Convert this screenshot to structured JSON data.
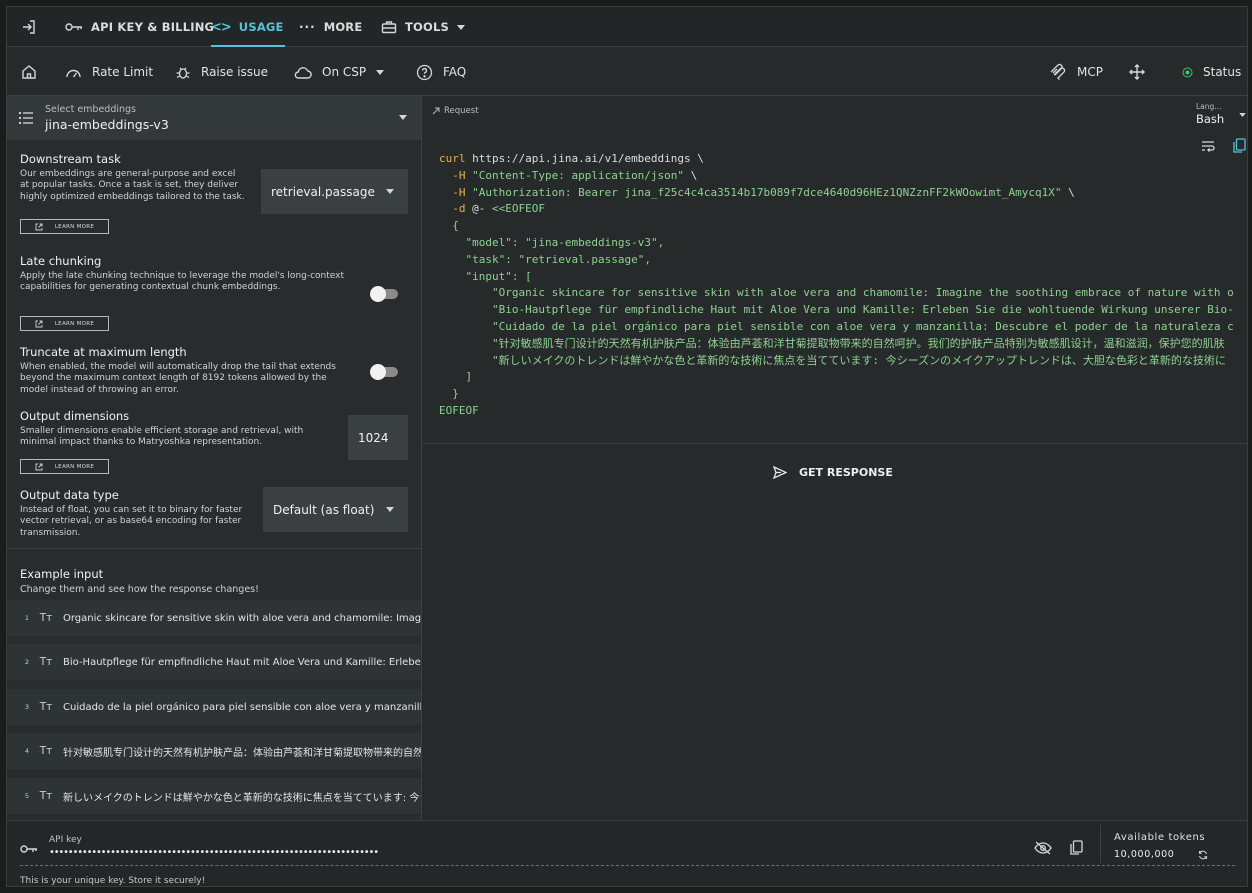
{
  "tabs": [
    {
      "label": "API KEY & BILLING"
    },
    {
      "label": "USAGE"
    },
    {
      "label": "MORE"
    },
    {
      "label": "TOOLS"
    }
  ],
  "toolbar": {
    "rate_limit": "Rate Limit",
    "raise_issue": "Raise issue",
    "on_csp": "On CSP",
    "faq": "FAQ",
    "mcp": "MCP",
    "status": "Status"
  },
  "embeddings": {
    "label": "Select embeddings",
    "value": "jina-embeddings-v3"
  },
  "settings": {
    "learn_more": "LEARN MORE",
    "downstream": {
      "title": "Downstream task",
      "desc": "Our embeddings are general-purpose and excel at popular tasks. Once a task is set, they deliver highly optimized embeddings tailored to the task.",
      "value": "retrieval.passage"
    },
    "late_chunking": {
      "title": "Late chunking",
      "desc": "Apply the late chunking technique to leverage the model's long-context capabilities for generating contextual chunk embeddings."
    },
    "truncate": {
      "title": "Truncate at maximum length",
      "desc": "When enabled, the model will automatically drop the tail that extends beyond the maximum context length of 8192 tokens allowed by the model instead of throwing an error."
    },
    "dimensions": {
      "title": "Output dimensions",
      "desc": "Smaller dimensions enable efficient storage and retrieval, with minimal impact thanks to Matryoshka representation.",
      "value": "1024"
    },
    "datatype": {
      "title": "Output data type",
      "desc": "Instead of float, you can set it to binary for faster vector retrieval, or as base64 encoding for faster transmission.",
      "value": "Default (as float)"
    }
  },
  "example": {
    "title": "Example input",
    "subtitle": "Change them and see how the response changes!",
    "tt_glyph": "Tт",
    "items": [
      {
        "n": "1",
        "text": "Organic skincare for sensitive skin with aloe vera and chamomile: Imagine the soothing embrace of nature with our organic skincare range"
      },
      {
        "n": "2",
        "text": "Bio-Hautpflege für empfindliche Haut mit Aloe Vera und Kamille: Erleben Sie die wohltuende Wirkung unserer Bio-Hautpflege"
      },
      {
        "n": "3",
        "text": "Cuidado de la piel orgánico para piel sensible con aloe vera y manzanilla: Descubre el poder de la naturaleza con nuestra línea"
      },
      {
        "n": "4",
        "text": "针对敏感肌专门设计的天然有机护肤产品：体验由芦荟和洋甘菊提取物带来的自然呵护。我们的护肤产品特别为敏感肌设计"
      },
      {
        "n": "5",
        "text": "新しいメイクのトレンドは鮮やかな色と革新的な技術に焦点を当てています: 今シーズンのメイクアップトレンドは、大胆な色彩と革新的な技術に"
      }
    ]
  },
  "request": {
    "label": "Request",
    "lang_label": "Lang...",
    "lang_value": "Bash",
    "get_response": "GET RESPONSE"
  },
  "code": {
    "l1a": "curl",
    "l1b": " https://api.jina.ai/v1/embeddings \\",
    "l2a": "  -H",
    "l2b": " \"Content-Type: application/json\"",
    "l2c": " \\",
    "l3a": "  -H",
    "l3b": " \"Authorization: Bearer jina_f25c4c4ca3514b17b089f7dce4640d96HEz1QNZznFF2kWOowimt_Amycq1X\"",
    "l3c": " \\",
    "l4a": "  -d",
    "l4b": " @- ",
    "l4c": "<<EOFEOF",
    "l5": "  {",
    "l6a": "    \"model\"",
    "l6b": ": ",
    "l6c": "\"jina-embeddings-v3\"",
    "l6d": ",",
    "l7a": "    \"task\"",
    "l7b": ": ",
    "l7c": "\"retrieval.passage\"",
    "l7d": ",",
    "l8a": "    \"input\"",
    "l8b": ": [",
    "l9": "        \"Organic skincare for sensitive skin with aloe vera and chamomile: Imagine the soothing embrace of nature with our",
    "l10": "        \"Bio-Hautpflege für empfindliche Haut mit Aloe Vera und Kamille: Erleben Sie die wohltuende Wirkung unserer Bio-Hautpflege",
    "l11": "        \"Cuidado de la piel orgánico para piel sensible con aloe vera y manzanilla: Descubre el poder de la naturaleza con",
    "l12": "        \"针对敏感肌专门设计的天然有机护肤产品：体验由芦荟和洋甘菊提取物带来的自然呵护。我们的护肤产品特别为敏感肌设计，温和滋润，保护您的肌肤",
    "l13": "        \"新しいメイクのトレンドは鮮やかな色と革新的な技術に焦点を当てています: 今シーズンのメイクアップトレンドは、大胆な色彩と革新的な技術に",
    "l14": "    ]",
    "l15": "  }",
    "l16": "EOFEOF"
  },
  "api_key": {
    "label": "API key",
    "value": "••••••••••••••••••••••••••••••••••••••••••••••••••••••••••••••••••••••",
    "hint": "This is your unique key. Store it securely!"
  },
  "tokens": {
    "label": "Available tokens",
    "value": "10,000,000"
  },
  "colors": {
    "accent": "#56c2d8",
    "status_green": "#3ec46d",
    "code_keyword": "#e4b54c",
    "code_string": "#8fd192"
  }
}
